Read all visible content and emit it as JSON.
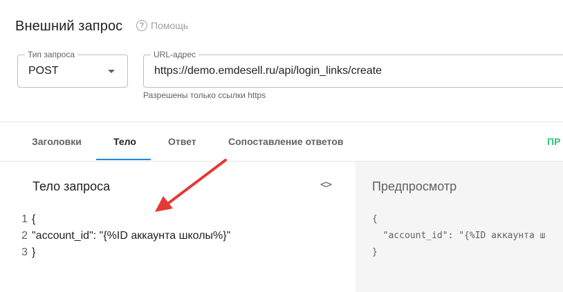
{
  "header": {
    "title": "Внешний запрос",
    "help_label": "Помощь",
    "help_icon": "help-circle-icon"
  },
  "request": {
    "method_label": "Тип запроса",
    "method_value": "POST",
    "url_label": "URL-адрес",
    "url_value": "https://demo.emdesell.ru/api/login_links/create",
    "url_hint": "Разрешены только ссылки https"
  },
  "tabs": [
    {
      "label": "Заголовки"
    },
    {
      "label": "Тело"
    },
    {
      "label": "Ответ"
    },
    {
      "label": "Сопоставление ответов"
    }
  ],
  "active_tab": "Тело",
  "tab_right_label": "ПР",
  "editor": {
    "title": "Тело запроса",
    "toggle_label": "<>",
    "lines": [
      {
        "number": "1",
        "text": "{"
      },
      {
        "number": "2",
        "text": "\"account_id\": \"{%ID аккаунта школы%}\""
      },
      {
        "number": "3",
        "text": "}"
      }
    ]
  },
  "preview": {
    "title": "Предпросмотр",
    "lines": [
      "{",
      "  \"account_id\": \"{%ID аккаунта ш",
      "}"
    ]
  },
  "colors": {
    "accent": "#1e88e5",
    "green": "#2ec27e",
    "arrow": "#e53935"
  }
}
